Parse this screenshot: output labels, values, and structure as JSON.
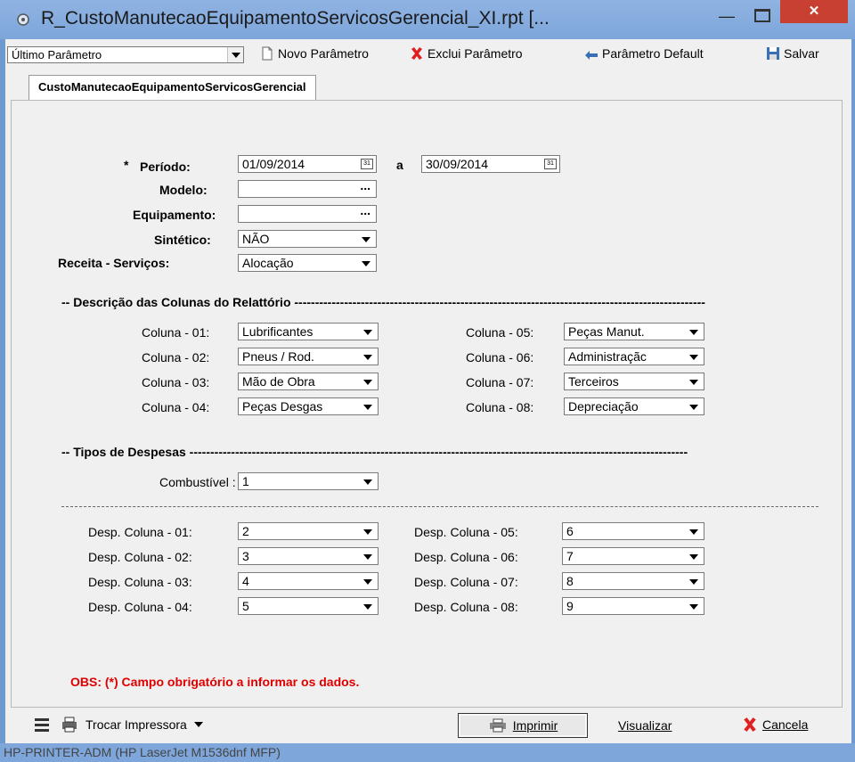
{
  "window": {
    "title": "R_CustoManutecaoEquipamentoServicosGerencial_XI.rpt [..."
  },
  "toolbar": {
    "param_combo": "Último Parâmetro",
    "novo": "Novo Parâmetro",
    "exclui": "Exclui Parâmetro",
    "default": "Parâmetro Default",
    "salvar": "Salvar"
  },
  "tab": {
    "label": "CustoManutecaoEquipamentoServicosGerencial"
  },
  "form": {
    "periodo_label": "Período:",
    "periodo_star": "*",
    "periodo_inicio": "01/09/2014",
    "periodo_a": "a",
    "periodo_fim": "30/09/2014",
    "modelo_label": "Modelo:",
    "equipamento_label": "Equipamento:",
    "sintetico_label": "Sintético:",
    "sintetico_value": "NÃO",
    "receita_label": "Receita - Serviços:",
    "receita_value": "Alocação"
  },
  "colunas": {
    "header": "-- Descrição das Colunas do Relattório ---------------------------------------------------------------------------------------------------",
    "items": [
      {
        "label": "Coluna - 01:",
        "value": "Lubrificantes"
      },
      {
        "label": "Coluna - 02:",
        "value": "Pneus / Rod."
      },
      {
        "label": "Coluna - 03:",
        "value": "Mão de Obra"
      },
      {
        "label": "Coluna - 04:",
        "value": "Peças Desgas"
      },
      {
        "label": "Coluna - 05:",
        "value": "Peças Manut."
      },
      {
        "label": "Coluna - 06:",
        "value": "Administraçãc"
      },
      {
        "label": "Coluna - 07:",
        "value": "Terceiros"
      },
      {
        "label": "Coluna - 08:",
        "value": "Depreciação"
      }
    ]
  },
  "despesas": {
    "header": "-- Tipos de Despesas ------------------------------------------------------------------------------------------------------------------------",
    "combustivel_label": "Combustível :",
    "combustivel_value": "1",
    "items": [
      {
        "label": "Desp. Coluna - 01:",
        "value": "2"
      },
      {
        "label": "Desp. Coluna - 02:",
        "value": "3"
      },
      {
        "label": "Desp. Coluna - 03:",
        "value": "4"
      },
      {
        "label": "Desp. Coluna - 04:",
        "value": "5"
      },
      {
        "label": "Desp. Coluna - 05:",
        "value": "6"
      },
      {
        "label": "Desp. Coluna - 06:",
        "value": "7"
      },
      {
        "label": "Desp. Coluna - 07:",
        "value": "8"
      },
      {
        "label": "Desp. Coluna - 08:",
        "value": "9"
      }
    ]
  },
  "obs": "OBS: (*) Campo obrigatório a informar os dados.",
  "bottom": {
    "trocar": "Trocar Impressora",
    "imprimir": "Imprimir",
    "visualizar": "Visualizar",
    "cancela": "Cancela"
  },
  "taskbar": {
    "printer": "HP-PRINTER-ADM (HP LaserJet M1536dnf MFP)"
  }
}
